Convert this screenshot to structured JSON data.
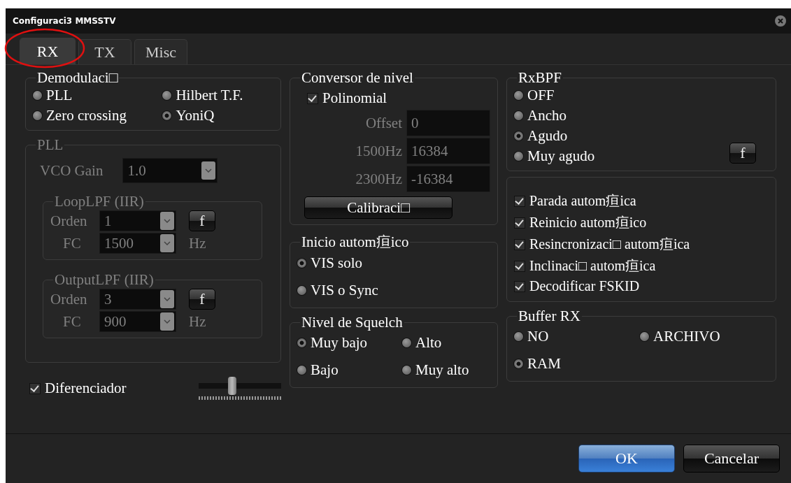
{
  "window": {
    "title": "Configuraci3 MMSSTV"
  },
  "tabs": [
    {
      "label": "RX",
      "selected": true,
      "circled": true
    },
    {
      "label": "TX",
      "selected": false,
      "circled": false
    },
    {
      "label": "Misc",
      "selected": false,
      "circled": false
    }
  ],
  "demodulation": {
    "title": "Demodulaci□",
    "options": [
      {
        "label": "PLL",
        "selected": false
      },
      {
        "label": "Hilbert T.F.",
        "selected": false
      },
      {
        "label": "Zero crossing",
        "selected": false
      },
      {
        "label": "YoniQ",
        "selected": true
      }
    ]
  },
  "pll": {
    "title": "PLL",
    "disabled": true,
    "vco_gain": {
      "label": "VCO Gain",
      "value": "1.0"
    },
    "filters": [
      {
        "title": "LoopLPF (IIR)",
        "order_label": "Orden",
        "order": "1",
        "fc_label": "FC",
        "fc": "1500",
        "unit": "Hz",
        "button": "f"
      },
      {
        "title": "OutputLPF (IIR)",
        "order_label": "Orden",
        "order": "3",
        "fc_label": "FC",
        "fc": "900",
        "unit": "Hz",
        "button": "f"
      }
    ]
  },
  "differentiator": {
    "label": "Diferenciador",
    "checked": true,
    "level": 0.4
  },
  "level_converter": {
    "title": "Conversor de nivel",
    "polynomial": {
      "label": "Polinomial",
      "checked": true
    },
    "fields": [
      {
        "label": "Offset",
        "value": "0",
        "disabled": true
      },
      {
        "label": "1500Hz",
        "value": "16384",
        "disabled": true
      },
      {
        "label": "2300Hz",
        "value": "-16384",
        "disabled": true
      }
    ],
    "button": "Calibraci□"
  },
  "auto_start": {
    "title": "Inicio autom疸ico",
    "options": [
      {
        "label": "VIS solo",
        "selected": true
      },
      {
        "label": "VIS o Sync",
        "selected": false
      }
    ]
  },
  "squelch": {
    "title": "Nivel de Squelch",
    "options": [
      {
        "label": "Muy bajo",
        "selected": true
      },
      {
        "label": "Alto",
        "selected": false
      },
      {
        "label": "Bajo",
        "selected": false
      },
      {
        "label": "Muy alto",
        "selected": false
      }
    ]
  },
  "rxbpf": {
    "title": "RxBPF",
    "button": "f",
    "options": [
      {
        "label": "OFF",
        "selected": false
      },
      {
        "label": "Ancho",
        "selected": false
      },
      {
        "label": "Agudo",
        "selected": true
      },
      {
        "label": "Muy agudo",
        "selected": false
      }
    ]
  },
  "auto_options": [
    {
      "label": "Parada autom疸ica",
      "checked": true
    },
    {
      "label": "Reinicio autom疸ico",
      "checked": true
    },
    {
      "label": "Resincronizaci□ autom疸ica",
      "checked": true
    },
    {
      "label": "Inclinaci□ autom疸ica",
      "checked": true
    },
    {
      "label": "Decodificar FSKID",
      "checked": true
    }
  ],
  "buffer": {
    "title": "Buffer RX",
    "options": [
      {
        "label": "NO",
        "selected": false
      },
      {
        "label": "ARCHIVO",
        "selected": false
      },
      {
        "label": "RAM",
        "selected": true
      }
    ]
  },
  "buttons": [
    {
      "label": "OK",
      "kind": "primary"
    },
    {
      "label": "Cancelar",
      "kind": "default"
    }
  ]
}
